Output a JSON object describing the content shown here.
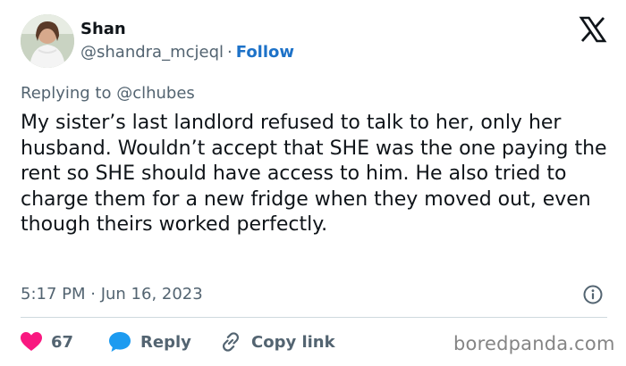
{
  "author": {
    "name": "Shan",
    "handle": "@shandra_mcjeql",
    "separator": "·",
    "follow_label": "Follow"
  },
  "reply_context": "Replying to @clhubes",
  "tweet": {
    "text": "My sister’s last landlord refused to talk to her, only her husband. Wouldn’t accept that SHE was the one paying the rent so SHE should have access to him. He also tried to charge them for a new fridge when they moved out, even though theirs worked perfectly.",
    "timestamp": "5:17 PM · Jun 16, 2023"
  },
  "actions": {
    "likes_count": "67",
    "reply_label": "Reply",
    "copy_link_label": "Copy link"
  },
  "watermark": "boredpanda.com",
  "colors": {
    "like": "#f91880",
    "reply": "#1d9bf0",
    "follow": "#1d72c8",
    "muted": "#536471",
    "text": "#0f1419",
    "divider": "#cfd9de"
  },
  "icons": {
    "logo": "x-logo-icon",
    "info": "info-icon",
    "like": "heart-icon",
    "reply": "speech-bubble-icon",
    "copy_link": "link-icon"
  }
}
